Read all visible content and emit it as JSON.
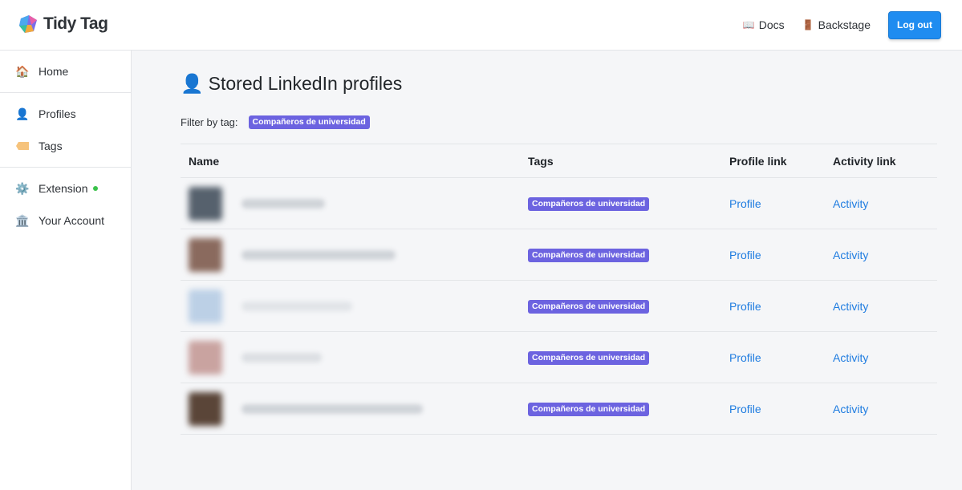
{
  "brand": {
    "name": "Tidy Tag"
  },
  "header": {
    "docs_label": "Docs",
    "backstage_label": "Backstage",
    "logout_label": "Log out"
  },
  "sidebar": {
    "items": [
      {
        "label": "Home",
        "icon": "house-icon"
      },
      {
        "label": "Profiles",
        "icon": "person-icon"
      },
      {
        "label": "Tags",
        "icon": "tag-icon"
      },
      {
        "label": "Extension",
        "icon": "gear-icon",
        "status": "online"
      },
      {
        "label": "Your Account",
        "icon": "bank-icon"
      }
    ]
  },
  "main": {
    "title": "Stored LinkedIn profiles",
    "filter_label": "Filter by tag:",
    "filter_tag": "Compañeros de universidad",
    "columns": [
      "Name",
      "Tags",
      "Profile link",
      "Activity link"
    ],
    "rows": [
      {
        "tag": "Compañeros de universidad",
        "profile": "Profile",
        "activity": "Activity"
      },
      {
        "tag": "Compañeros de universidad",
        "profile": "Profile",
        "activity": "Activity"
      },
      {
        "tag": "Compañeros de universidad",
        "profile": "Profile",
        "activity": "Activity"
      },
      {
        "tag": "Compañeros de universidad",
        "profile": "Profile",
        "activity": "Activity"
      },
      {
        "tag": "Compañeros de universidad",
        "profile": "Profile",
        "activity": "Activity"
      }
    ]
  },
  "colors": {
    "accent": "#1f8cf0",
    "tag": "#6c63e0",
    "link": "#1f7ce0",
    "status_online": "#3ac24a"
  }
}
